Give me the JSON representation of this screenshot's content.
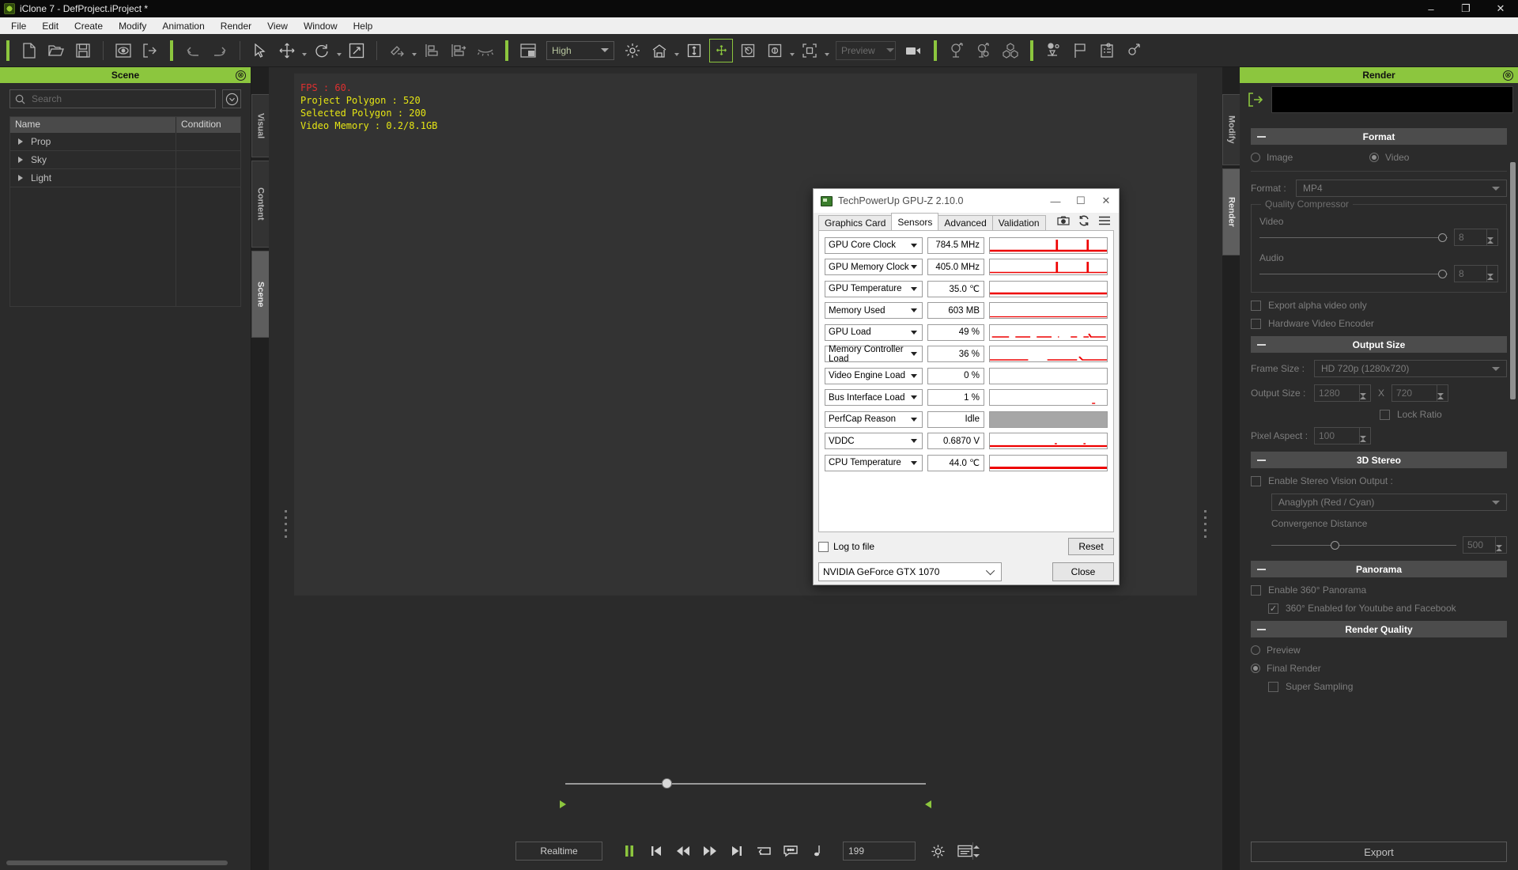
{
  "window": {
    "title": "iClone 7 - DefProject.iProject *",
    "app_icon": "iclone-logo-icon",
    "minimize": "–",
    "maximize": "❐",
    "close": "✕"
  },
  "menubar": {
    "items": [
      "File",
      "Edit",
      "Create",
      "Modify",
      "Animation",
      "Render",
      "View",
      "Window",
      "Help"
    ]
  },
  "toolbar": {
    "quality_label": "High",
    "preview_label": "Preview",
    "icons": [
      "new-file-icon",
      "open-folder-icon",
      "save-icon",
      "render-preview-icon",
      "export-icon",
      "undo-icon",
      "redo-icon",
      "select-arrow-icon",
      "move-tool-icon",
      "rotate-tool-icon",
      "scale-tool-icon",
      "link-icon",
      "align-icon",
      "align-distribute-icon",
      "hide-icon",
      "viewport-layout-icon",
      "light-icon",
      "home-icon",
      "ground-icon",
      "move-gizmo-icon",
      "camera-angle-icon",
      "render-mode-icon",
      "frame-all-icon",
      "video-camera-icon",
      "actor-icon",
      "actor-eye-icon",
      "props-icon",
      "physics-icon",
      "flag-icon",
      "checklist-icon",
      "plugin-icon"
    ]
  },
  "left_panel": {
    "title": "Scene",
    "close_icon": "⊗",
    "search": {
      "placeholder": "Search",
      "value": "",
      "icon": "search-icon"
    },
    "filter_icon": "chevron-circle-down-icon",
    "columns": [
      "Name",
      "Condition"
    ],
    "rows": [
      {
        "name": "Prop",
        "condition": ""
      },
      {
        "name": "Sky",
        "condition": ""
      },
      {
        "name": "Light",
        "condition": ""
      }
    ],
    "vtabs": [
      "Visual",
      "Content",
      "Scene"
    ],
    "active_vtab": "Scene"
  },
  "viewport": {
    "stats": {
      "fps": "FPS : 60.",
      "project_polygon": "Project Polygon : 520",
      "selected_polygon": "Selected Polygon : 200",
      "video_memory": "Video Memory : 0.2/8.1GB"
    },
    "fps_color": "#e03030",
    "stats_color": "#e5e514"
  },
  "transport": {
    "mode_label": "Realtime",
    "frame_value": "199",
    "buttons": [
      "pause-icon",
      "skip-to-start-icon",
      "rewind-icon",
      "fast-forward-icon",
      "skip-to-end-icon",
      "loop-icon",
      "comment-icon",
      "note-icon"
    ],
    "settings_icon": "gear-icon",
    "timeline-icon": "timeline-icon"
  },
  "right_panel": {
    "title": "Render",
    "close_icon": "⊗",
    "export_icon": "export-arrow-icon",
    "vtabs": [
      "Modify",
      "Render"
    ],
    "active_vtab": "Render",
    "sections": {
      "format": {
        "header": "Format",
        "image_label": "Image",
        "video_label": "Video",
        "selected": "Video",
        "format_label": "Format :",
        "format_value": "MP4",
        "quality_group": "Quality Compressor",
        "video_label2": "Video",
        "video_value": "8",
        "audio_label": "Audio",
        "audio_value": "8",
        "export_alpha": "Export alpha video only",
        "export_alpha_checked": false,
        "hw_encoder": "Hardware Video Encoder",
        "hw_encoder_checked": false
      },
      "output_size": {
        "header": "Output Size",
        "frame_size_label": "Frame Size :",
        "frame_size_value": "HD 720p (1280x720)",
        "output_size_label": "Output Size :",
        "width": "1280",
        "separator": "X",
        "height": "720",
        "lock_ratio": "Lock Ratio",
        "lock_ratio_checked": false,
        "pixel_aspect_label": "Pixel Aspect :",
        "pixel_aspect_value": "100"
      },
      "stereo_3d": {
        "header": "3D Stereo",
        "enable_label": "Enable Stereo Vision Output :",
        "enable_checked": false,
        "mode_value": "Anaglyph (Red / Cyan)",
        "convergence_label": "Convergence Distance",
        "convergence_value": "500"
      },
      "panorama": {
        "header": "Panorama",
        "enable_label": "Enable 360° Panorama",
        "enable_checked": false,
        "youtube_label": "360° Enabled for Youtube and Facebook",
        "youtube_checked": true,
        "check_glyph": "✓"
      },
      "render_quality": {
        "header": "Render Quality",
        "preview_label": "Preview",
        "final_label": "Final Render",
        "selected": "Final Render",
        "super_sampling": "Super Sampling",
        "super_sampling_checked": false
      }
    },
    "export_button": "Export"
  },
  "gpuz": {
    "title": "TechPowerUp GPU-Z 2.10.0",
    "icon": "gpu-card-icon",
    "minimize": "—",
    "maximize": "☐",
    "close": "✕",
    "tabs": [
      "Graphics Card",
      "Sensors",
      "Advanced",
      "Validation"
    ],
    "active_tab": "Sensors",
    "tool_icons": [
      "camera-icon",
      "refresh-icon",
      "menu-icon"
    ],
    "sensors": [
      {
        "name": "GPU Core Clock",
        "value": "784.5 MHz",
        "graph": "spikes-high"
      },
      {
        "name": "GPU Memory Clock",
        "value": "405.0 MHz",
        "graph": "spikes-mid"
      },
      {
        "name": "GPU Temperature",
        "value": "35.0 ℃",
        "graph": "flat-low"
      },
      {
        "name": "Memory Used",
        "value": "603 MB",
        "graph": "flat-bottom"
      },
      {
        "name": "GPU Load",
        "value": "49 %",
        "graph": "noisy-low"
      },
      {
        "name": "Memory Controller Load",
        "value": "36 %",
        "graph": "noisy-low2"
      },
      {
        "name": "Video Engine Load",
        "value": "0 %",
        "graph": "empty"
      },
      {
        "name": "Bus Interface Load",
        "value": "1 %",
        "graph": "tiny-dot"
      },
      {
        "name": "PerfCap Reason",
        "value": "Idle",
        "graph": "grey"
      },
      {
        "name": "VDDC",
        "value": "0.6870 V",
        "graph": "flat-low2"
      },
      {
        "name": "CPU Temperature",
        "value": "44.0 ℃",
        "graph": "flat-low3"
      }
    ],
    "log_to_file": "Log to file",
    "log_checked": false,
    "reset_button": "Reset",
    "gpu_select": "NVIDIA GeForce GTX 1070",
    "close_button": "Close"
  }
}
